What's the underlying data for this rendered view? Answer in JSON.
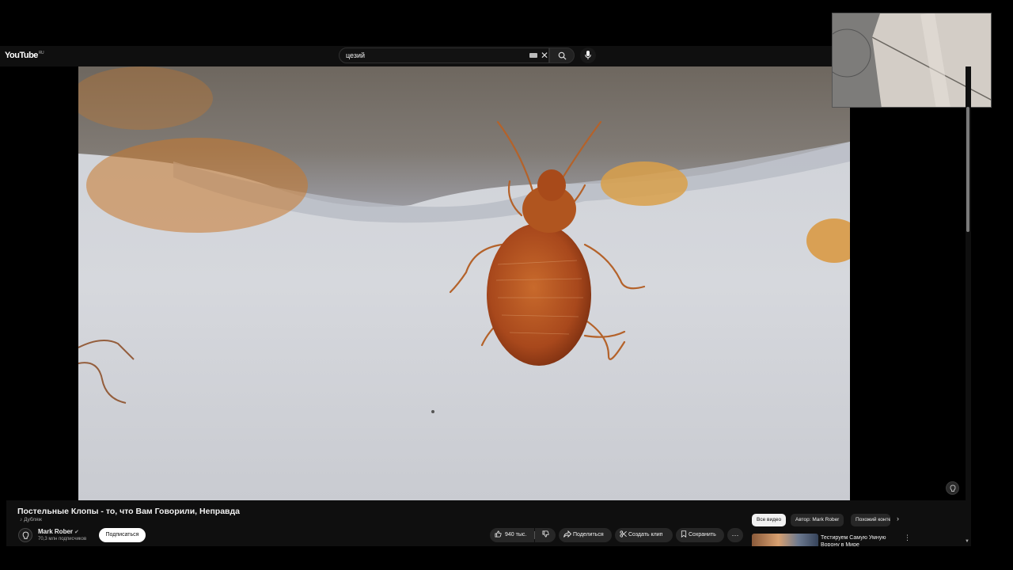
{
  "masthead": {
    "logo": "YouTube",
    "logo_region": "RU",
    "search_value": "цезий",
    "icons": [
      "keyboard-icon",
      "clear-icon",
      "search-icon",
      "mic-icon"
    ]
  },
  "video": {
    "title": "Постельные Клопы - то, что Вам Говорили, Неправда",
    "dubbing": "Дубляж",
    "channel_name": "Mark Rober",
    "subscribers": "70,3 млн подписчиков",
    "subscribe_label": "Подписаться"
  },
  "actions": {
    "likes": "940 тыс.",
    "share": "Поделиться",
    "clip": "Создать клип",
    "save": "Сохранить",
    "more": "···"
  },
  "chips": {
    "all": "Все видео",
    "author": "Автор: Mark Rober",
    "similar": "Похожий контент"
  },
  "recommendation": {
    "title": "Тестируем Самую Умную Ворону в Мире"
  },
  "colors": {
    "background": "#0f0f0f",
    "pill": "#272727",
    "accent_white": "#f1f1f1"
  }
}
